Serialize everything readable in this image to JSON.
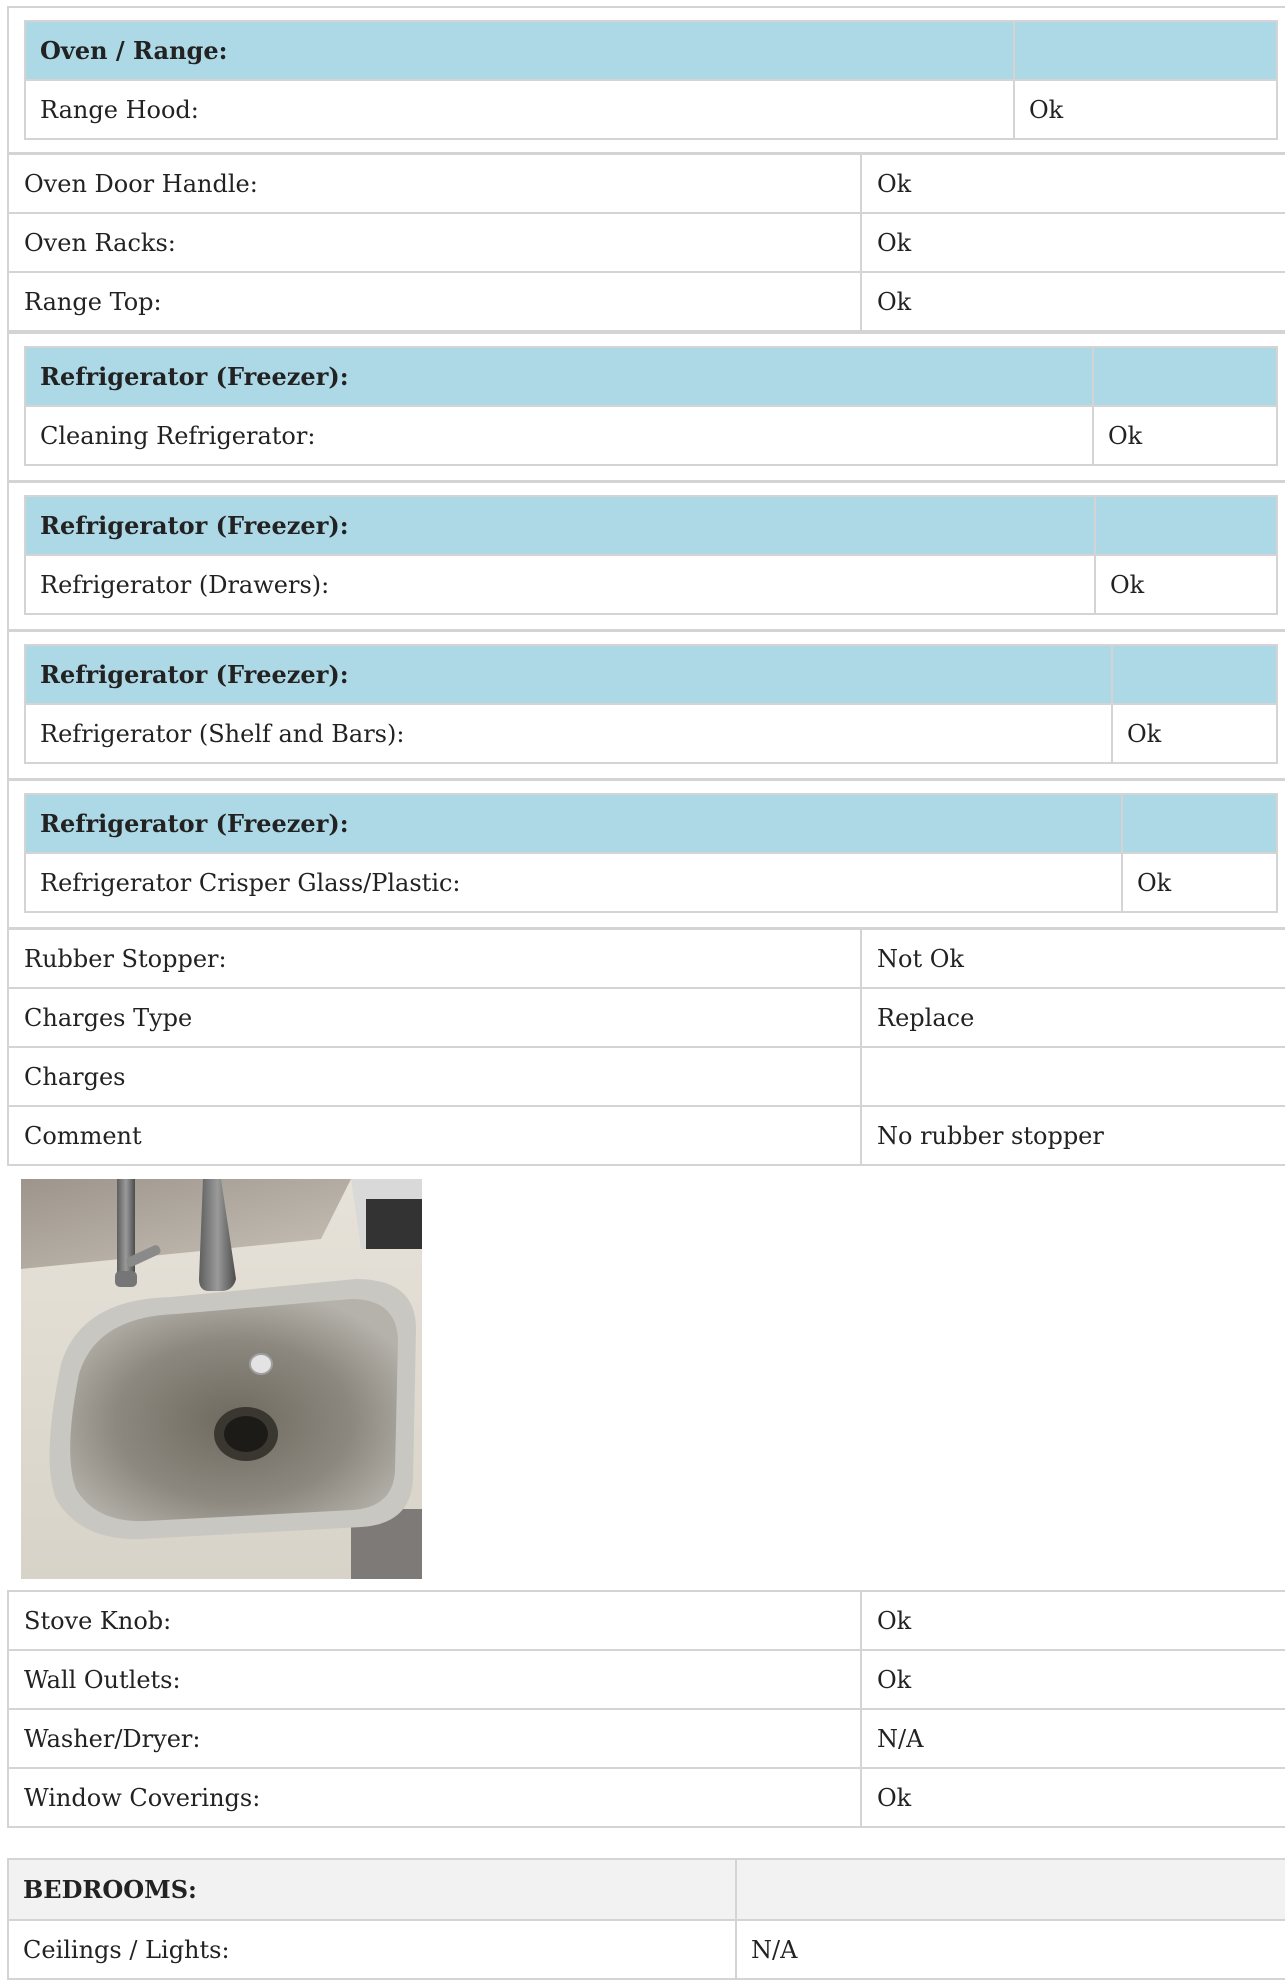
{
  "ovenRange": {
    "title": "Oven / Range:",
    "items": [
      {
        "label": "Range Hood:",
        "value": "Ok"
      }
    ]
  },
  "ovenItems": [
    {
      "label": "Oven Door Handle:",
      "value": "Ok"
    },
    {
      "label": "Oven Racks:",
      "value": "Ok"
    },
    {
      "label": "Range Top:",
      "value": "Ok"
    }
  ],
  "fridgeSections": [
    {
      "title": "Refrigerator (Freezer):",
      "label": "Cleaning Refrigerator:",
      "value": "Ok"
    },
    {
      "title": "Refrigerator (Freezer):",
      "label": "Refrigerator (Drawers):",
      "value": "Ok"
    },
    {
      "title": "Refrigerator (Freezer):",
      "label": "Refrigerator (Shelf and Bars):",
      "value": "Ok"
    },
    {
      "title": "Refrigerator (Freezer):",
      "label": "Refrigerator Crisper Glass/Plastic:",
      "value": "Ok"
    }
  ],
  "rubberStopper": [
    {
      "label": "Rubber Stopper:",
      "value": "Not Ok"
    },
    {
      "label": "Charges Type",
      "value": "Replace"
    },
    {
      "label": "Charges",
      "value": ""
    },
    {
      "label": "Comment",
      "value": "No rubber stopper"
    }
  ],
  "finalItems": [
    {
      "label": "Stove Knob:",
      "value": "Ok"
    },
    {
      "label": "Wall Outlets:",
      "value": "Ok"
    },
    {
      "label": "Washer/Dryer:",
      "value": "N/A"
    },
    {
      "label": "Window Coverings:",
      "value": "Ok"
    }
  ],
  "bedrooms": {
    "title": "BEDROOMS:",
    "items": [
      {
        "label": "Ceilings / Lights:",
        "value": "N/A"
      }
    ]
  },
  "colors": {
    "subHeader": "#add8e6",
    "bedHeader": "#f2f2f2",
    "border": "#d4d4d4"
  }
}
